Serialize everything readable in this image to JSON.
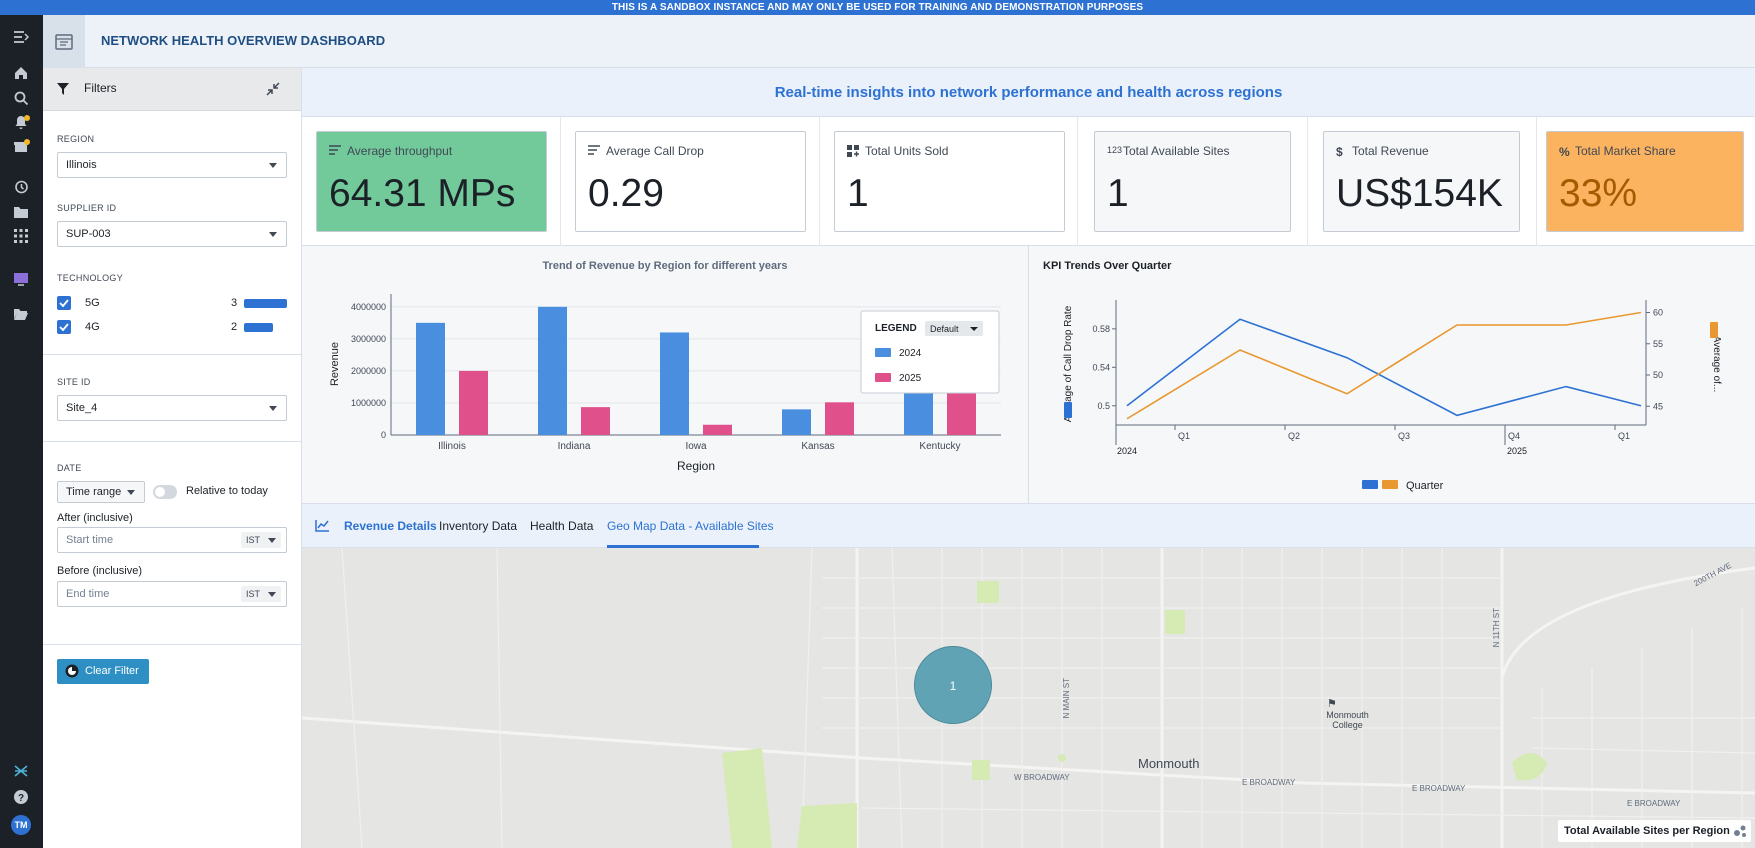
{
  "banner": {
    "text": "THIS IS A SANDBOX INSTANCE AND MAY ONLY BE USED FOR TRAINING AND DEMONSTRATION PURPOSES",
    "handle": "•••"
  },
  "rail": {
    "icons": [
      "menu-expand-icon",
      "home-icon",
      "search-icon",
      "notifications-icon",
      "gift-icon",
      "history-icon",
      "folder-icon",
      "apps-grid-icon",
      "dashboard-icon",
      "folder-open-icon",
      "ontology-icon",
      "help-icon"
    ],
    "avatar_initials": "TM"
  },
  "app": {
    "title": "NETWORK HEALTH OVERVIEW DASHBOARD"
  },
  "filters": {
    "title": "Filters",
    "region": {
      "label": "REGION",
      "value": "Illinois"
    },
    "supplier": {
      "label": "SUPPLIER ID",
      "value": "SUP-003"
    },
    "technology": {
      "label": "TECHNOLOGY",
      "options": [
        {
          "label": "5G",
          "count": "3",
          "checked": true,
          "fraction": 1.0
        },
        {
          "label": "4G",
          "count": "2",
          "checked": true,
          "fraction": 0.67
        }
      ]
    },
    "site": {
      "label": "SITE ID",
      "value": "Site_4"
    },
    "date": {
      "label": "DATE",
      "mode": "Time range",
      "relative_label": "Relative to today",
      "after_label": "After (inclusive)",
      "after_placeholder": "Start time",
      "before_label": "Before (inclusive)",
      "before_placeholder": "End time",
      "timezone": "IST"
    },
    "clear_label": "Clear Filter"
  },
  "main": {
    "subtitle": "Real-time insights into network performance and health across regions",
    "kpis": [
      {
        "label": "Average throughput",
        "value": "64.31 MPs",
        "icon": "text-align-icon",
        "bg": "#72ca9b"
      },
      {
        "label": "Average Call Drop",
        "value": "0.29",
        "icon": "text-align-icon",
        "bg": "#ffffff"
      },
      {
        "label": "Total Units Sold",
        "value": "1",
        "icon": "grid-plus-icon",
        "bg": "#ffffff"
      },
      {
        "label": "Total Available Sites",
        "value": "1",
        "icon": "numeric-icon",
        "icon_text": "123",
        "bg": "#f6f7f9"
      },
      {
        "label": "Total Revenue",
        "value": "US$154K",
        "icon": "dollar-icon",
        "icon_text": "$",
        "bg": "#f6f7f9"
      },
      {
        "label": "Total Market Share",
        "value": "33%",
        "icon": "percent-icon",
        "icon_text": "%",
        "bg": "#fbb360",
        "value_color": "#a55a00"
      }
    ],
    "tabs": [
      "Revenue Details",
      "Inventory Data",
      "Health Data",
      "Geo Map Data - Available Sites"
    ],
    "active_tab": "Geo Map Data - Available Sites"
  },
  "chart_data": [
    {
      "type": "bar",
      "title": "Trend of Revenue by Region for different years",
      "xlabel": "Region",
      "ylabel": "Revenue",
      "categories": [
        "Illinois",
        "Indiana",
        "Iowa",
        "Kansas",
        "Kentucky"
      ],
      "series": [
        {
          "name": "2024",
          "values": [
            3500000,
            4000000,
            3200000,
            800000,
            2000000
          ],
          "color": "#4a8ee0"
        },
        {
          "name": "2025",
          "values": [
            2000000,
            870000,
            320000,
            1020000,
            1700000
          ],
          "color": "#e0508a"
        }
      ],
      "ylim": [
        0,
        4400000
      ],
      "yticks": [
        "0",
        "1000000",
        "2000000",
        "3000000",
        "4000000"
      ],
      "legend": {
        "title": "LEGEND",
        "dropdown": "Default",
        "placement": "top-right"
      }
    },
    {
      "type": "line",
      "title": "KPI Trends Over Quarter",
      "xlabel": "Quarter",
      "y_left_label": "Average of Call Drop Rate",
      "y_right_label": "Average of...",
      "x_ticks": [
        "Q1",
        "Q2",
        "Q3",
        "Q4",
        "Q1"
      ],
      "x_year_labels": [
        "2024",
        "2025"
      ],
      "left_ticks": [
        "0.5",
        "0.54",
        "0.58"
      ],
      "right_ticks": [
        "45",
        "50",
        "55",
        "60"
      ],
      "left_range": [
        0.48,
        0.61
      ],
      "right_range": [
        42,
        62
      ],
      "series": [
        {
          "name": "Average of Call Drop Rate",
          "axis": "left",
          "values": [
            0.5,
            0.59,
            0.55,
            0.49,
            0.52,
            0.5
          ],
          "color": "#2d72d2"
        },
        {
          "name": "Average of...",
          "axis": "right",
          "values": [
            43,
            54,
            47,
            58,
            58,
            60
          ],
          "color": "#e9972f"
        }
      ]
    }
  ],
  "map": {
    "cluster_count": "1",
    "streets": [
      "N MAIN ST",
      "N 11TH ST",
      "W BROADWAY",
      "E BROADWAY",
      "E BROADWAY",
      "E BROADWAY",
      "200TH AVE"
    ],
    "city": "Monmouth",
    "college": "Monmouth College",
    "legend_label": "Total Available Sites per Region"
  }
}
